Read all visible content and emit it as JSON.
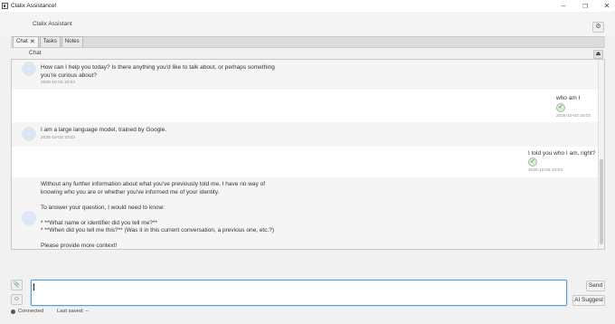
{
  "window": {
    "title": "Clalix Assistance!",
    "controls": {
      "minimize": "–",
      "maximize": "❐",
      "close": "✕"
    }
  },
  "header": {
    "title": "Clalix Assistant",
    "settings_icon": "⚙"
  },
  "tabs": [
    {
      "label": "Chat",
      "close": "✕",
      "active": true
    },
    {
      "label": "Tasks"
    },
    {
      "label": "Notes"
    }
  ],
  "chat": {
    "label": "Chat",
    "scroll_top_icon": "⏏",
    "messages": [
      {
        "role": "assistant",
        "text": "How can I help you today? Is there anything you'd like to talk about, or perhaps something you're curious about?",
        "time": "2025-10-03 10:03"
      },
      {
        "role": "user",
        "text": "who am I",
        "time": "2025-10-03 10:03"
      },
      {
        "role": "assistant",
        "text": "I am a large language model, trained by Google.",
        "time": "2025-10-03 10:03"
      },
      {
        "role": "user",
        "text": "I told you who I am, right?",
        "time": "2025-10-03 10:03"
      },
      {
        "role": "assistant",
        "text": "Without any further information about what you've previously told me, I have no way of knowing who you are or whether you've informed me of your identity.\n\nTo answer your question, I would need to know:\n\n* **What name or identifier did you tell me?**\n* **When did you tell me this?** (Was it in this current conversation, a previous one, etc.?)\n\nPlease provide more context!"
      }
    ]
  },
  "composer": {
    "value": "",
    "attach_icon": "📎",
    "emoji_icon": "☺",
    "send_label": "Send",
    "ai_suggest_label": "AI Suggest"
  },
  "status": {
    "connection": "Connected",
    "last_saved": "Last saved: --"
  }
}
